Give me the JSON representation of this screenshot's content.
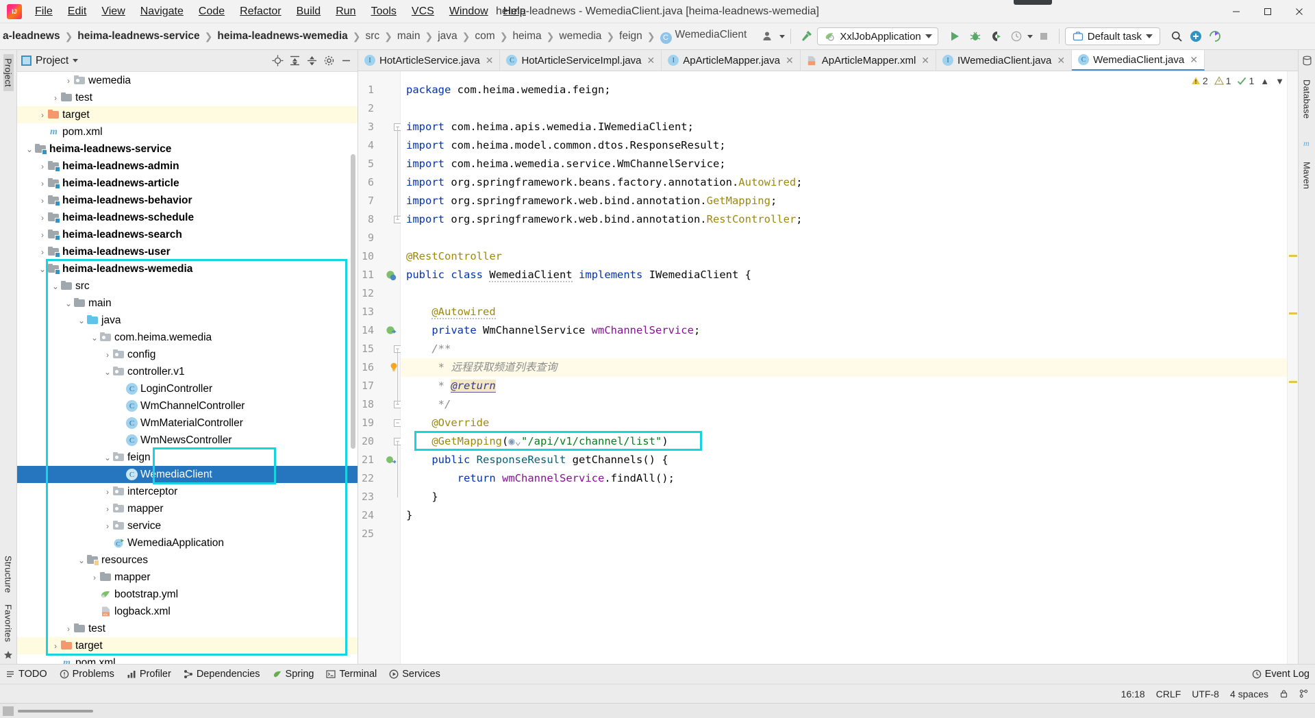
{
  "window": {
    "title": "heima-leadnews - WemediaClient.java [heima-leadnews-wemedia]",
    "minimize": "─",
    "maximize": "☐",
    "close": "✕"
  },
  "menubar": {
    "items": [
      {
        "label": "File"
      },
      {
        "label": "Edit"
      },
      {
        "label": "View"
      },
      {
        "label": "Navigate"
      },
      {
        "label": "Code"
      },
      {
        "label": "Refactor"
      },
      {
        "label": "Build"
      },
      {
        "label": "Run"
      },
      {
        "label": "Tools"
      },
      {
        "label": "VCS"
      },
      {
        "label": "Window"
      },
      {
        "label": "Help"
      }
    ]
  },
  "navbar": {
    "breadcrumbs": [
      {
        "label": "a-leadnews",
        "bold": true,
        "icon": null
      },
      {
        "label": "heima-leadnews-service",
        "bold": true,
        "icon": null
      },
      {
        "label": "heima-leadnews-wemedia",
        "bold": true,
        "icon": null
      },
      {
        "label": "src",
        "bold": false,
        "icon": null
      },
      {
        "label": "main",
        "bold": false,
        "icon": null
      },
      {
        "label": "java",
        "bold": false,
        "icon": null
      },
      {
        "label": "com",
        "bold": false,
        "icon": null
      },
      {
        "label": "heima",
        "bold": false,
        "icon": null
      },
      {
        "label": "wemedia",
        "bold": false,
        "icon": null
      },
      {
        "label": "feign",
        "bold": false,
        "icon": null
      },
      {
        "label": "WemediaClient",
        "bold": false,
        "icon": "class-icon"
      }
    ],
    "separator": "❯",
    "run_config": "XxlJobApplication",
    "task_label": "Default task",
    "icons": {
      "avatar": "user-avatar-icon",
      "hammer": "build-hammer-icon",
      "run": "run-icon",
      "debug": "debug-icon",
      "coverage": "run-with-coverage-icon",
      "profiler": "profiler-icon",
      "stop": "stop-icon",
      "search": "search-icon",
      "plus": "add-icon",
      "updates": "updates-icon"
    }
  },
  "left_rail": {
    "top": [
      "Project"
    ],
    "bottom": [
      "Structure",
      "Favorites"
    ]
  },
  "right_rail": {
    "items": [
      "Database",
      "Maven"
    ]
  },
  "project_panel": {
    "title": "Project",
    "actions": [
      "locate-icon",
      "expand-all-icon",
      "collapse-all-icon",
      "settings-gear-icon",
      "hide-icon"
    ],
    "tree": [
      {
        "depth": 5,
        "label": "wemedia",
        "icon": "package",
        "arrow": "collapsed",
        "bold": false
      },
      {
        "depth": 4,
        "label": "test",
        "icon": "folder",
        "arrow": "collapsed",
        "bold": false
      },
      {
        "depth": 3,
        "label": "target",
        "icon": "folder-orange",
        "arrow": "collapsed",
        "bold": false,
        "highlight": true
      },
      {
        "depth": 3,
        "label": "pom.xml",
        "icon": "maven",
        "arrow": "none",
        "bold": false
      },
      {
        "depth": 2,
        "label": "heima-leadnews-service",
        "icon": "module",
        "arrow": "expanded",
        "bold": true
      },
      {
        "depth": 3,
        "label": "heima-leadnews-admin",
        "icon": "module",
        "arrow": "collapsed",
        "bold": true
      },
      {
        "depth": 3,
        "label": "heima-leadnews-article",
        "icon": "module",
        "arrow": "collapsed",
        "bold": true
      },
      {
        "depth": 3,
        "label": "heima-leadnews-behavior",
        "icon": "module",
        "arrow": "collapsed",
        "bold": true
      },
      {
        "depth": 3,
        "label": "heima-leadnews-schedule",
        "icon": "module",
        "arrow": "collapsed",
        "bold": true
      },
      {
        "depth": 3,
        "label": "heima-leadnews-search",
        "icon": "module",
        "arrow": "collapsed",
        "bold": true
      },
      {
        "depth": 3,
        "label": "heima-leadnews-user",
        "icon": "module",
        "arrow": "collapsed",
        "bold": true
      },
      {
        "depth": 3,
        "label": "heima-leadnews-wemedia",
        "icon": "module",
        "arrow": "expanded",
        "bold": true
      },
      {
        "depth": 4,
        "label": "src",
        "icon": "folder",
        "arrow": "expanded",
        "bold": false
      },
      {
        "depth": 5,
        "label": "main",
        "icon": "folder",
        "arrow": "expanded",
        "bold": false
      },
      {
        "depth": 6,
        "label": "java",
        "icon": "folder-blue",
        "arrow": "expanded",
        "bold": false
      },
      {
        "depth": 7,
        "label": "com.heima.wemedia",
        "icon": "package",
        "arrow": "expanded",
        "bold": false
      },
      {
        "depth": 8,
        "label": "config",
        "icon": "package",
        "arrow": "collapsed",
        "bold": false
      },
      {
        "depth": 8,
        "label": "controller.v1",
        "icon": "package",
        "arrow": "expanded",
        "bold": false
      },
      {
        "depth": 9,
        "label": "LoginController",
        "icon": "class",
        "arrow": "none",
        "bold": false
      },
      {
        "depth": 9,
        "label": "WmChannelController",
        "icon": "class",
        "arrow": "none",
        "bold": false
      },
      {
        "depth": 9,
        "label": "WmMaterialController",
        "icon": "class",
        "arrow": "none",
        "bold": false
      },
      {
        "depth": 9,
        "label": "WmNewsController",
        "icon": "class",
        "arrow": "none",
        "bold": false
      },
      {
        "depth": 8,
        "label": "feign",
        "icon": "package",
        "arrow": "expanded",
        "bold": false
      },
      {
        "depth": 9,
        "label": "WemediaClient",
        "icon": "class",
        "arrow": "none",
        "bold": false,
        "selected": true
      },
      {
        "depth": 8,
        "label": "interceptor",
        "icon": "package",
        "arrow": "collapsed",
        "bold": false
      },
      {
        "depth": 8,
        "label": "mapper",
        "icon": "package",
        "arrow": "collapsed",
        "bold": false
      },
      {
        "depth": 8,
        "label": "service",
        "icon": "package",
        "arrow": "collapsed",
        "bold": false
      },
      {
        "depth": 8,
        "label": "WemediaApplication",
        "icon": "spring",
        "arrow": "none",
        "bold": false
      },
      {
        "depth": 6,
        "label": "resources",
        "icon": "resources",
        "arrow": "expanded",
        "bold": false
      },
      {
        "depth": 7,
        "label": "mapper",
        "icon": "folder",
        "arrow": "collapsed",
        "bold": false
      },
      {
        "depth": 7,
        "label": "bootstrap.yml",
        "icon": "spring-yml",
        "arrow": "none",
        "bold": false
      },
      {
        "depth": 7,
        "label": "logback.xml",
        "icon": "xml",
        "arrow": "none",
        "bold": false
      },
      {
        "depth": 5,
        "label": "test",
        "icon": "folder",
        "arrow": "collapsed",
        "bold": false
      },
      {
        "depth": 4,
        "label": "target",
        "icon": "folder-orange",
        "arrow": "collapsed",
        "bold": false,
        "highlight": true
      },
      {
        "depth": 4,
        "label": "pom.xml",
        "icon": "maven",
        "arrow": "none",
        "bold": false
      }
    ]
  },
  "editor": {
    "tabs": [
      {
        "label": "HotArticleService.java",
        "icon": "interface-icon",
        "active": false,
        "close": "✕"
      },
      {
        "label": "HotArticleServiceImpl.java",
        "icon": "class-icon",
        "active": false,
        "close": "✕"
      },
      {
        "label": "ApArticleMapper.java",
        "icon": "interface-icon",
        "active": false,
        "close": "✕"
      },
      {
        "label": "ApArticleMapper.xml",
        "icon": "xml-icon",
        "active": false,
        "close": "✕"
      },
      {
        "label": "IWemediaClient.java",
        "icon": "interface-icon",
        "active": false,
        "close": "✕"
      },
      {
        "label": "WemediaClient.java",
        "icon": "class-icon",
        "active": true,
        "close": "✕"
      }
    ],
    "inspection_counts": {
      "warnings": "2",
      "weak_warnings": "1",
      "typos": "1",
      "chevron_up": "⌃",
      "chevron_down": "⌄"
    },
    "lines": [
      {
        "n": "1",
        "text": "package com.heima.wemedia.feign;"
      },
      {
        "n": "2",
        "text": ""
      },
      {
        "n": "3",
        "text": "import com.heima.apis.wemedia.IWemediaClient;"
      },
      {
        "n": "4",
        "text": "import com.heima.model.common.dtos.ResponseResult;"
      },
      {
        "n": "5",
        "text": "import com.heima.wemedia.service.WmChannelService;"
      },
      {
        "n": "6",
        "text": "import org.springframework.beans.factory.annotation.Autowired;"
      },
      {
        "n": "7",
        "text": "import org.springframework.web.bind.annotation.GetMapping;"
      },
      {
        "n": "8",
        "text": "import org.springframework.web.bind.annotation.RestController;"
      },
      {
        "n": "9",
        "text": ""
      },
      {
        "n": "10",
        "text": "@RestController"
      },
      {
        "n": "11",
        "text": "public class WemediaClient implements IWemediaClient {"
      },
      {
        "n": "12",
        "text": ""
      },
      {
        "n": "13",
        "text": "    @Autowired"
      },
      {
        "n": "14",
        "text": "    private WmChannelService wmChannelService;"
      },
      {
        "n": "15",
        "text": "    /**"
      },
      {
        "n": "16",
        "text": "     * 远程获取频道列表查询"
      },
      {
        "n": "17",
        "text": "     * @return"
      },
      {
        "n": "18",
        "text": "     */"
      },
      {
        "n": "19",
        "text": "    @Override"
      },
      {
        "n": "20",
        "text": "    @GetMapping(\"/api/v1/channel/list\")"
      },
      {
        "n": "21",
        "text": "    public ResponseResult getChannels() {"
      },
      {
        "n": "22",
        "text": "        return wmChannelService.findAll();"
      },
      {
        "n": "23",
        "text": "    }"
      },
      {
        "n": "24",
        "text": "}"
      },
      {
        "n": "25",
        "text": ""
      }
    ],
    "tokens": {
      "l1": [
        "package ",
        "com.heima.wemedia.feign;"
      ],
      "javadoc_comment": "远程获取频道列表查询",
      "javadoc_return": "@return",
      "mapping_path": "\"/api/v1/channel/list\"",
      "mapping_name": "@GetMapping"
    }
  },
  "bottom_bar": {
    "items": [
      {
        "label": "TODO",
        "icon": "todo-icon"
      },
      {
        "label": "Problems",
        "icon": "problems-icon"
      },
      {
        "label": "Profiler",
        "icon": "profiler-icon"
      },
      {
        "label": "Dependencies",
        "icon": "dependencies-icon"
      },
      {
        "label": "Spring",
        "icon": "spring-icon"
      },
      {
        "label": "Terminal",
        "icon": "terminal-icon"
      },
      {
        "label": "Services",
        "icon": "services-icon"
      }
    ],
    "event_log": "Event Log",
    "event_log_icon": "event-log-icon"
  },
  "statusbar": {
    "time": "16:18",
    "line_sep": "CRLF",
    "encoding": "UTF-8",
    "indent": "4 spaces",
    "lock_icon": "lock-icon",
    "branch_icon": "branch-icon"
  },
  "colors": {
    "highlight_box": "#16d5e0",
    "selection": "#2675bf",
    "accent_blue": "#3592c4",
    "green_run": "#59a869",
    "keyword": "#0033b3",
    "annotation": "#9e880d",
    "string": "#067d17",
    "field": "#871094",
    "method": "#00627a",
    "comment": "#8c8c8c",
    "yellow_row": "#fffbe0"
  }
}
